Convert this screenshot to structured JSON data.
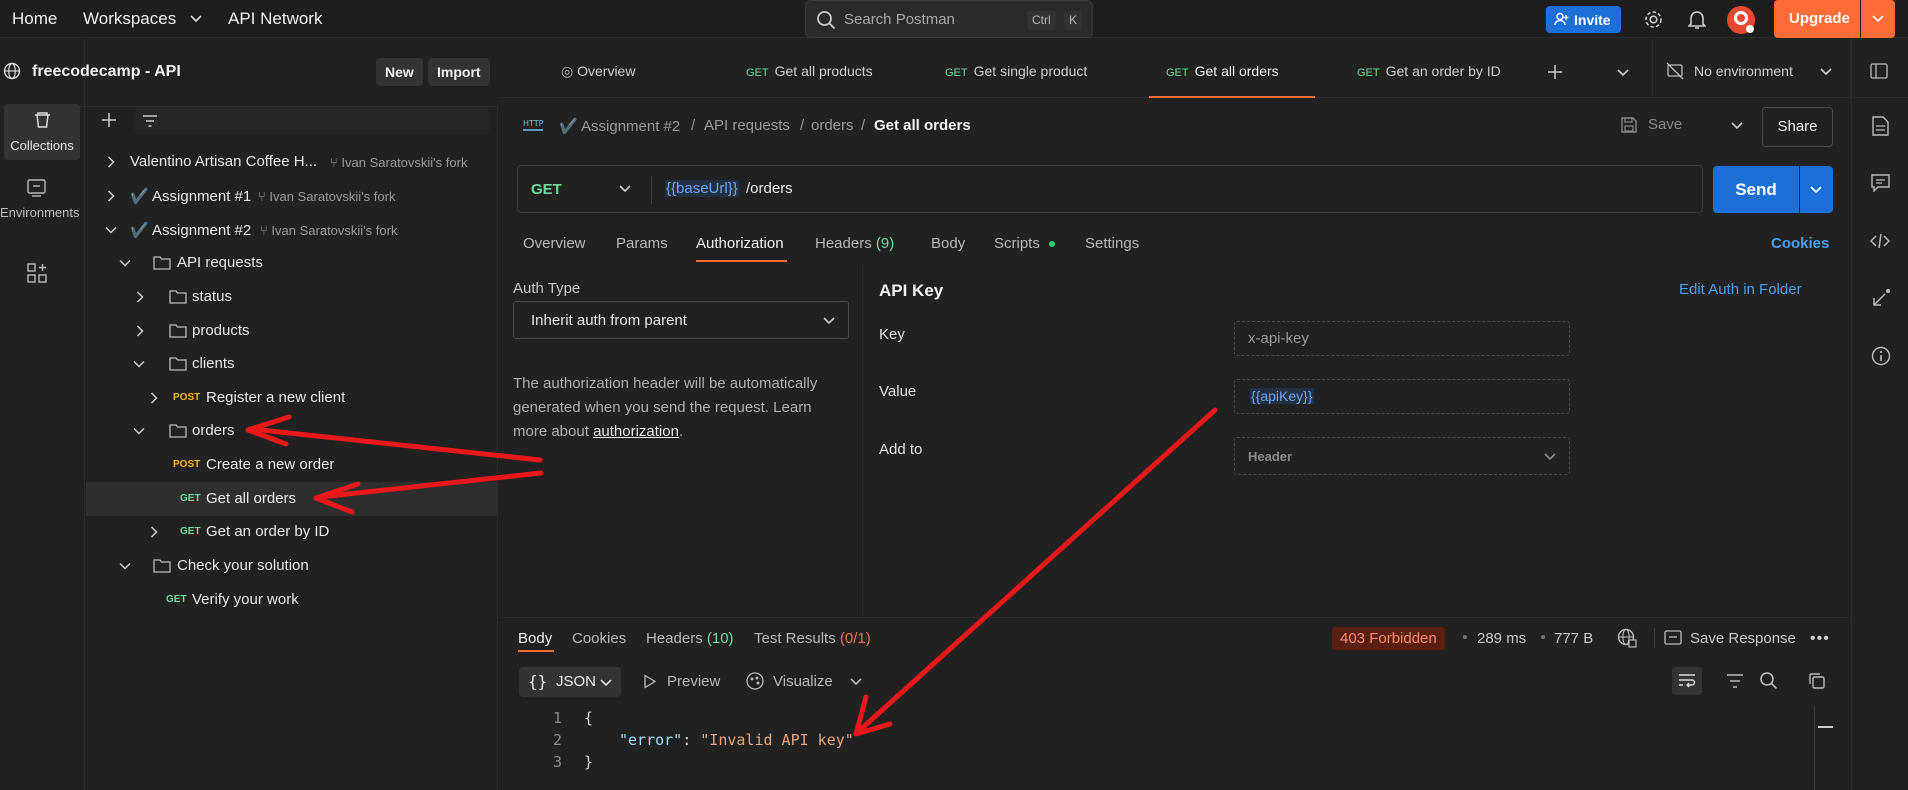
{
  "topbar": {
    "home": "Home",
    "workspaces": "Workspaces",
    "api_network": "API Network",
    "search_placeholder": "Search Postman",
    "shortcut_ctrl": "Ctrl",
    "shortcut_k": "K",
    "invite": "Invite",
    "upgrade": "Upgrade"
  },
  "rail": {
    "collections": "Collections",
    "environments": "Environments"
  },
  "workspace": {
    "name": "freecodecamp - API",
    "new": "New",
    "import": "Import"
  },
  "tree": [
    {
      "label": "Valentino Artisan Coffee H...",
      "fork": "Ivan Saratovskii's fork"
    },
    {
      "label": "✔️ Assignment #1",
      "fork": "Ivan Saratovskii's fork"
    },
    {
      "label": "✔️ Assignment #2",
      "fork": "Ivan Saratovskii's fork"
    },
    {
      "label": "API requests"
    },
    {
      "label": "status"
    },
    {
      "label": "products"
    },
    {
      "label": "clients"
    },
    {
      "method": "POST",
      "label": "Register a new client"
    },
    {
      "label": "orders"
    },
    {
      "method": "POST",
      "label": "Create a new order"
    },
    {
      "method": "GET",
      "label": "Get all orders"
    },
    {
      "method": "GET",
      "label": "Get an order by ID"
    },
    {
      "label": "Check your solution"
    },
    {
      "method": "GET",
      "label": "Verify your work"
    }
  ],
  "tabs": [
    {
      "label": "Overview"
    },
    {
      "method": "GET",
      "label": "Get all products"
    },
    {
      "method": "GET",
      "label": "Get single product"
    },
    {
      "method": "GET",
      "label": "Get all orders"
    },
    {
      "method": "GET",
      "label": "Get an order by ID"
    }
  ],
  "environment": "No environment",
  "breadcrumb": {
    "c1": "✔️ Assignment #2",
    "sep": "/",
    "c2": "API requests",
    "c3": "orders",
    "current": "Get all orders"
  },
  "actions": {
    "save": "Save",
    "share": "Share"
  },
  "request": {
    "method": "GET",
    "url_var": "{{baseUrl}}",
    "url_path": "/orders",
    "send": "Send"
  },
  "request_tabs": {
    "overview": "Overview",
    "params": "Params",
    "authorization": "Authorization",
    "headers": "Headers",
    "headers_count": "(9)",
    "body": "Body",
    "scripts": "Scripts",
    "settings": "Settings",
    "cookies": "Cookies"
  },
  "auth": {
    "type_label": "Auth Type",
    "type_value": "Inherit auth from parent",
    "desc_1": "The authorization header will be automatically",
    "desc_2": "generated when you send the request. Learn",
    "desc_3": "more about",
    "desc_link": "authorization",
    "desc_end": ".",
    "section_title": "API Key",
    "edit_link": "Edit Auth in Folder",
    "key_label": "Key",
    "key_value": "x-api-key",
    "value_label": "Value",
    "value_value": "{{apiKey}}",
    "addto_label": "Add to",
    "addto_value": "Header"
  },
  "response": {
    "tab_body": "Body",
    "tab_cookies": "Cookies",
    "tab_headers": "Headers",
    "headers_count": "(10)",
    "tab_tests": "Test Results",
    "tests_count": "(0/1)",
    "status": "403 Forbidden",
    "time": "289 ms",
    "size": "777 B",
    "save_response": "Save Response",
    "format": "JSON",
    "preview": "Preview",
    "visualize": "Visualize",
    "lines": [
      {
        "n": "1",
        "text": "{"
      },
      {
        "n": "2",
        "key": "\"error\"",
        "colon": ": ",
        "value": "\"Invalid API key\""
      },
      {
        "n": "3",
        "text": "}"
      }
    ]
  },
  "colors": {
    "accent": "#ff6c37",
    "primary": "#1d6fd8",
    "get": "#6bdd9a",
    "post": "#ffb400",
    "error_arrow": "#e8181b"
  }
}
